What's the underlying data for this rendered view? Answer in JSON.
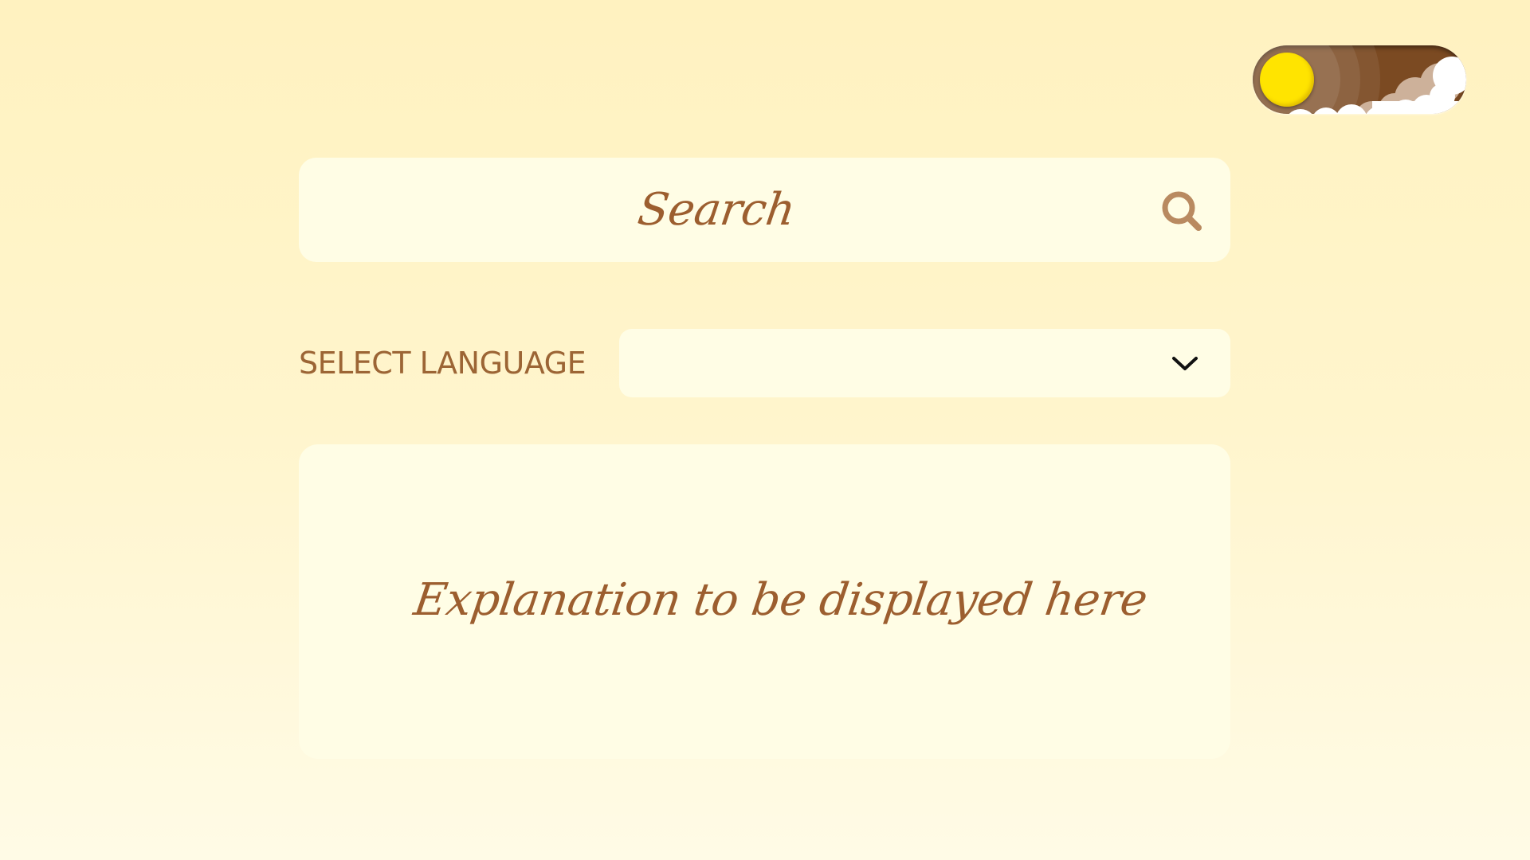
{
  "theme_toggle": {
    "state": "light",
    "track_color": "#7b4a22",
    "sun_color": "#ffe400",
    "icon": "sun-icon"
  },
  "search": {
    "placeholder": "Search",
    "icon": "search-icon",
    "icon_color": "#b98a60"
  },
  "language": {
    "label": "SELECT LANGUAGE",
    "selected": "",
    "icon": "chevron-down-icon"
  },
  "explanation": {
    "text": "Explanation to be displayed here"
  },
  "colors": {
    "background": "#fff2c0",
    "panel": "#fffde5",
    "text": "#9c5e2f"
  }
}
